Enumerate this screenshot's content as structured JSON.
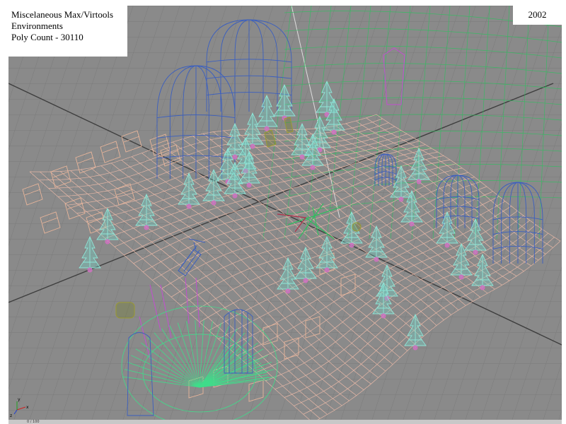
{
  "overlay": {
    "line1": "Miscelaneous Max/Virtools",
    "line2": "Environments",
    "line3": "Poly Count - 30110",
    "year": "2002"
  },
  "timeline": {
    "frame_counter": "0 / 100"
  },
  "axis_gizmo": {
    "x_label": "x",
    "y_label": "y",
    "z_label": "z"
  },
  "colors": {
    "viewport_bg": "#8a8a8a",
    "grid_line": "#7a7a7a",
    "grid_major": "#4a4a4a",
    "terrain_mesh": "#e6b7a6",
    "tree_wire": "#8fe6d8",
    "tent_wire": "#3b5fbf",
    "green_wire": "#2fbf5f",
    "magenta_wire": "#c24fd0",
    "olive_wire": "#9a9a30"
  },
  "icons": [
    "axis-gizmo-icon"
  ]
}
